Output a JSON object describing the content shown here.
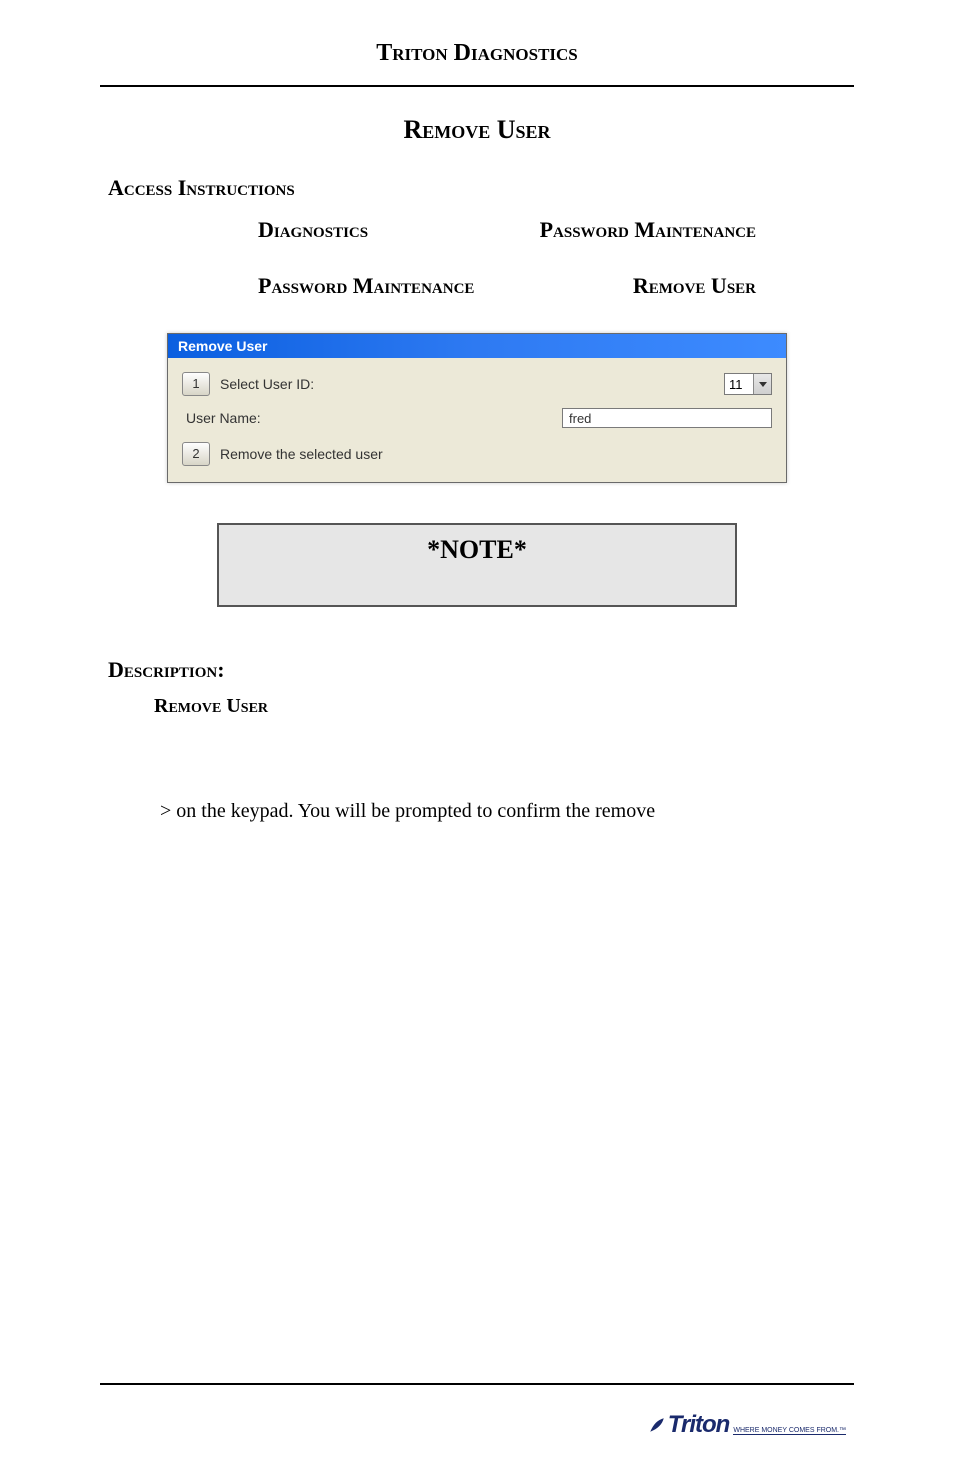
{
  "header": {
    "title": "Triton Diagnostics"
  },
  "section": {
    "title": "Remove User"
  },
  "access": {
    "heading": "Access Instructions",
    "row1_left": "Diagnostics",
    "row1_right": "Password Maintenance",
    "row2_left": "Password Maintenance",
    "row2_right": "Remove User"
  },
  "dialog": {
    "title": "Remove User",
    "step1_num": "1",
    "select_user_id_label": "Select User ID:",
    "user_id_value": "11",
    "user_name_label": "User Name:",
    "user_name_value": "fred",
    "step2_num": "2",
    "remove_label": "Remove the selected user"
  },
  "note": {
    "title": "*NOTE*"
  },
  "description": {
    "heading": "Description:",
    "sub": "Remove User",
    "body": "> on the keypad.  You will be prompted to confirm the remove"
  },
  "brand": {
    "name": "Triton",
    "tagline": "WHERE MONEY COMES FROM.™"
  }
}
